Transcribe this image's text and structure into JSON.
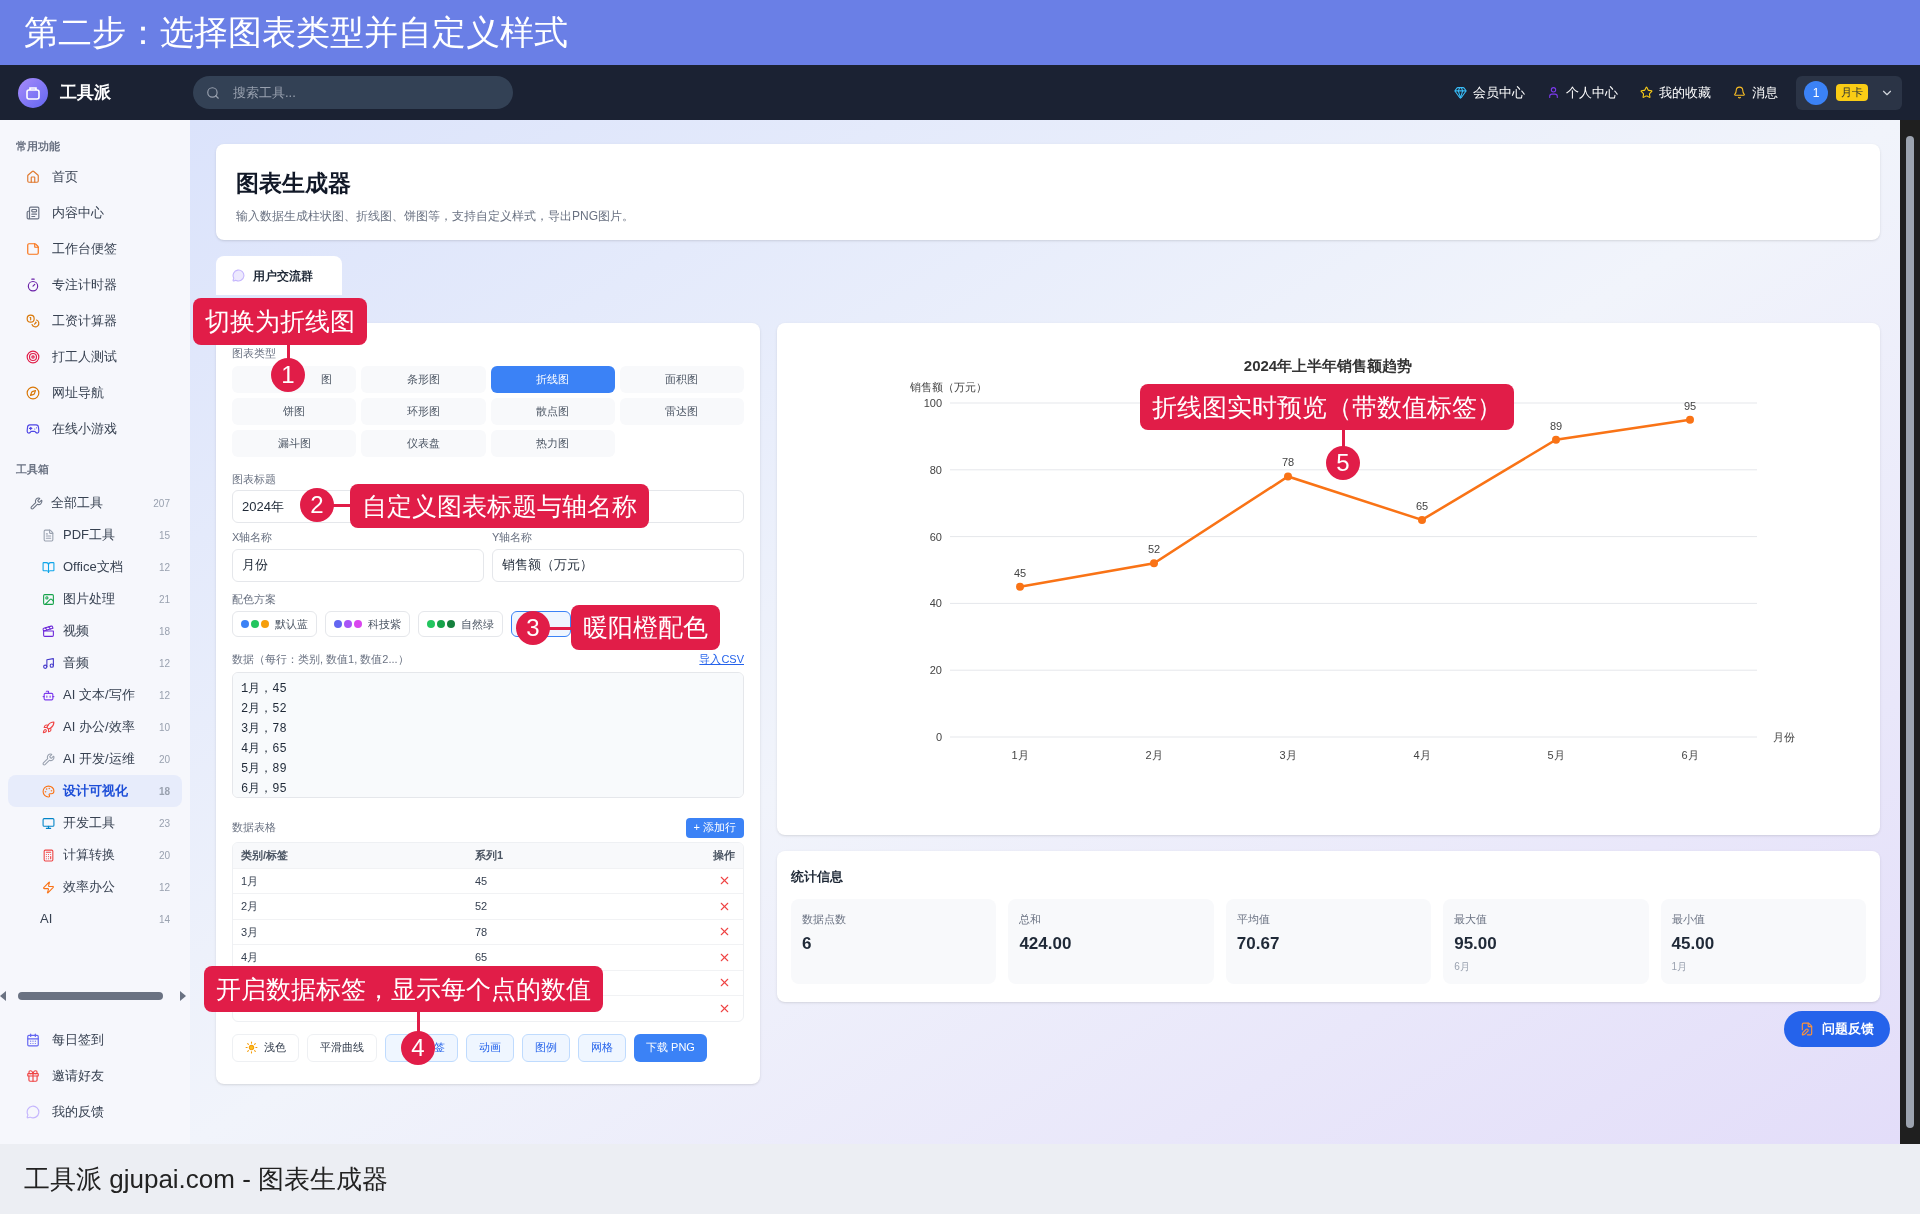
{
  "banner": {
    "title": "第二步：选择图表类型并自定义样式"
  },
  "navbar": {
    "brand": "工具派",
    "search": {
      "placeholder": "搜索工具..."
    },
    "links": [
      {
        "label": "会员中心"
      },
      {
        "label": "个人中心"
      },
      {
        "label": "我的收藏"
      },
      {
        "label": "消息"
      }
    ],
    "user": {
      "avatar": "1",
      "badge": "月卡"
    }
  },
  "sidebar": {
    "sections": [
      {
        "title": "常用功能",
        "items": [
          {
            "label": "首页",
            "selected": false
          },
          {
            "label": "内容中心",
            "selected": false
          },
          {
            "label": "工作台便签",
            "selected": false
          },
          {
            "label": "专注计时器",
            "selected": false
          },
          {
            "label": "工资计算器",
            "selected": false
          },
          {
            "label": "打工人测试",
            "selected": false
          },
          {
            "label": "网址导航",
            "selected": false
          },
          {
            "label": "在线小游戏",
            "selected": false
          }
        ]
      },
      {
        "title": "工具箱",
        "items": [
          {
            "label": "全部工具",
            "count": "207",
            "selected": false,
            "children": [
              {
                "label": "PDF工具",
                "count": "15",
                "selected": false
              },
              {
                "label": "Office文档",
                "count": "12",
                "selected": false
              },
              {
                "label": "图片处理",
                "count": "21",
                "selected": false
              },
              {
                "label": "视频",
                "count": "18",
                "selected": false
              },
              {
                "label": "音频",
                "count": "12",
                "selected": false
              },
              {
                "label": "AI 文本/写作",
                "count": "12",
                "selected": false
              },
              {
                "label": "AI 办公/效率",
                "count": "10",
                "selected": false
              },
              {
                "label": "AI 开发/运维",
                "count": "20",
                "selected": false
              },
              {
                "label": "设计可视化",
                "count": "18",
                "selected": true
              },
              {
                "label": "开发工具",
                "count": "23",
                "selected": false
              },
              {
                "label": "计算转换",
                "count": "20",
                "selected": false
              },
              {
                "label": "效率办公",
                "count": "12",
                "selected": false
              }
            ]
          },
          {
            "label": "AI",
            "count": "14",
            "selected": false
          }
        ]
      }
    ],
    "footer_items": [
      {
        "label": "每日签到",
        "selected": false
      },
      {
        "label": "邀请好友",
        "selected": false
      },
      {
        "label": "我的反馈",
        "selected": false
      }
    ]
  },
  "header": {
    "title": "图表生成器",
    "subtitle": "输入数据生成柱状图、折线图、饼图等，支持自定义样式，导出PNG图片。"
  },
  "community_tab": {
    "label": "用户交流群"
  },
  "editor": {
    "chart_types": {
      "label": "图表类型",
      "options": [
        {
          "label": "图",
          "selected": false
        },
        {
          "label": "条形图",
          "selected": false
        },
        {
          "label": "折线图",
          "selected": true
        },
        {
          "label": "面积图",
          "selected": false
        },
        {
          "label": "饼图",
          "selected": false
        },
        {
          "label": "环形图",
          "selected": false
        },
        {
          "label": "散点图",
          "selected": false
        },
        {
          "label": "雷达图",
          "selected": false
        },
        {
          "label": "漏斗图",
          "selected": false
        },
        {
          "label": "仪表盘",
          "selected": false
        },
        {
          "label": "热力图",
          "selected": false
        }
      ]
    },
    "title_field": {
      "label": "图表标题",
      "value": "2024年"
    },
    "x_axis_field": {
      "label": "X轴名称",
      "value": "月份"
    },
    "y_axis_field": {
      "label": "Y轴名称",
      "value": "销售额（万元）"
    },
    "color_schemes": {
      "label": "配色方案",
      "options": [
        {
          "label": "默认蓝",
          "selected": false,
          "dots": [
            {
              "color": "#3b82f6"
            },
            {
              "color": "#22c55e"
            },
            {
              "color": "#f59e0b"
            }
          ]
        },
        {
          "label": "科技紫",
          "selected": false,
          "dots": [
            {
              "color": "#6366f1"
            },
            {
              "color": "#a855f7"
            },
            {
              "color": "#d946ef"
            }
          ]
        },
        {
          "label": "自然绿",
          "selected": false,
          "dots": [
            {
              "color": "#22c55e"
            },
            {
              "color": "#16a34a"
            },
            {
              "color": "#15803d"
            }
          ]
        },
        {
          "selected": true
        }
      ]
    },
    "data_input": {
      "label": "数据（每行：类别, 数值1, 数值2...）",
      "link": "导入CSV",
      "value": "1月，45\n2月，52\n3月，78\n4月，65\n5月，89\n6月，95"
    },
    "table": {
      "label": "数据表格",
      "add_button": "+ 添加行",
      "columns": [
        "类别/标签",
        "系列1",
        "操作"
      ],
      "rows": [
        {
          "kind": "data",
          "category": "1月",
          "value": "45"
        },
        {
          "kind": "data",
          "category": "2月",
          "value": "52"
        },
        {
          "kind": "data",
          "category": "3月",
          "value": "78"
        },
        {
          "kind": "data",
          "category": "4月",
          "value": "65"
        },
        {
          "kind": "covered"
        },
        {
          "kind": "covered"
        }
      ]
    },
    "toggles": [
      {
        "label": "浅色",
        "kind": "theme",
        "on": false
      },
      {
        "label": "平滑曲线",
        "kind": "plain",
        "on": false
      },
      {
        "label": "签",
        "kind": "plain",
        "on": true
      },
      {
        "label": "动画",
        "kind": "plain",
        "on": true
      },
      {
        "label": "图例",
        "kind": "plain",
        "on": true
      },
      {
        "label": "网格",
        "kind": "plain",
        "on": true
      }
    ],
    "download_button": "下载 PNG"
  },
  "chart": {
    "chart_data": {
      "type": "line",
      "title": "2024年上半年销售额趋势",
      "xlabel": "月份",
      "ylabel": "销售额（万元）",
      "categories": [
        "1月",
        "2月",
        "3月",
        "4月",
        "5月",
        "6月"
      ],
      "series": [
        {
          "color": "#f97316",
          "marker": true,
          "values": [
            45,
            52,
            78,
            65,
            89,
            95
          ]
        }
      ],
      "ylim": [
        0,
        100
      ],
      "yticks": [
        0,
        20,
        40,
        60,
        80,
        100
      ],
      "grid": true,
      "data_labels": true
    }
  },
  "stats": {
    "title": "统计信息",
    "cards": [
      {
        "label": "数据点数",
        "value": "6"
      },
      {
        "label": "总和",
        "value": "424.00"
      },
      {
        "label": "平均值",
        "value": "70.67"
      },
      {
        "label": "最大值",
        "value": "95.00",
        "note": "6月"
      },
      {
        "label": "最小值",
        "value": "45.00",
        "note": "1月"
      }
    ]
  },
  "feedback_button": "问题反馈",
  "callouts": [
    {
      "number": "1",
      "text": "切换为折线图"
    },
    {
      "number": "2",
      "text": "自定义图表标题与轴名称"
    },
    {
      "number": "3",
      "text": "暖阳橙配色"
    },
    {
      "number": "4",
      "text": "开启数据标签，显示每个点的数值"
    },
    {
      "number": "5",
      "text": "折线图实时预览（带数值标签）"
    }
  ],
  "footer": {
    "caption": "工具派 gjupai.com - 图表生成器"
  }
}
